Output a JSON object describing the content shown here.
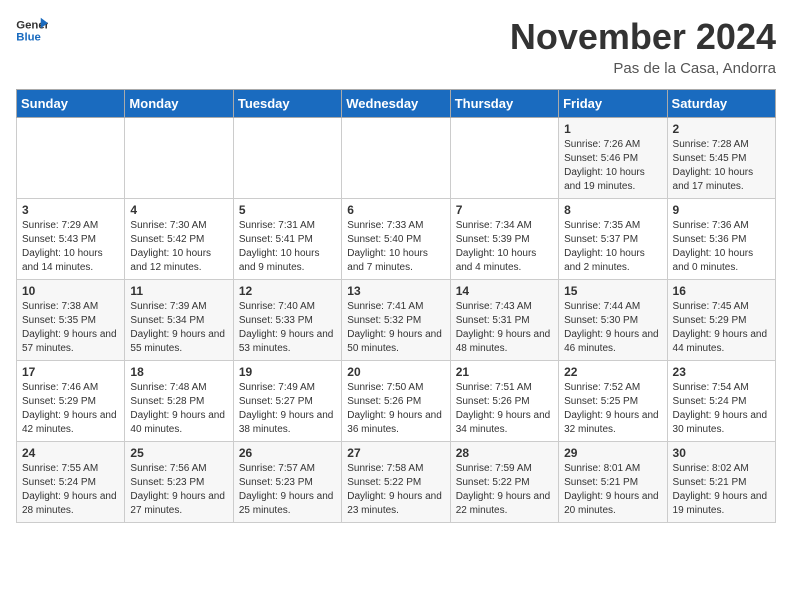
{
  "logo": {
    "line1": "General",
    "line2": "Blue"
  },
  "title": "November 2024",
  "subtitle": "Pas de la Casa, Andorra",
  "weekdays": [
    "Sunday",
    "Monday",
    "Tuesday",
    "Wednesday",
    "Thursday",
    "Friday",
    "Saturday"
  ],
  "weeks": [
    [
      {
        "day": "",
        "info": ""
      },
      {
        "day": "",
        "info": ""
      },
      {
        "day": "",
        "info": ""
      },
      {
        "day": "",
        "info": ""
      },
      {
        "day": "",
        "info": ""
      },
      {
        "day": "1",
        "info": "Sunrise: 7:26 AM\nSunset: 5:46 PM\nDaylight: 10 hours and 19 minutes."
      },
      {
        "day": "2",
        "info": "Sunrise: 7:28 AM\nSunset: 5:45 PM\nDaylight: 10 hours and 17 minutes."
      }
    ],
    [
      {
        "day": "3",
        "info": "Sunrise: 7:29 AM\nSunset: 5:43 PM\nDaylight: 10 hours and 14 minutes."
      },
      {
        "day": "4",
        "info": "Sunrise: 7:30 AM\nSunset: 5:42 PM\nDaylight: 10 hours and 12 minutes."
      },
      {
        "day": "5",
        "info": "Sunrise: 7:31 AM\nSunset: 5:41 PM\nDaylight: 10 hours and 9 minutes."
      },
      {
        "day": "6",
        "info": "Sunrise: 7:33 AM\nSunset: 5:40 PM\nDaylight: 10 hours and 7 minutes."
      },
      {
        "day": "7",
        "info": "Sunrise: 7:34 AM\nSunset: 5:39 PM\nDaylight: 10 hours and 4 minutes."
      },
      {
        "day": "8",
        "info": "Sunrise: 7:35 AM\nSunset: 5:37 PM\nDaylight: 10 hours and 2 minutes."
      },
      {
        "day": "9",
        "info": "Sunrise: 7:36 AM\nSunset: 5:36 PM\nDaylight: 10 hours and 0 minutes."
      }
    ],
    [
      {
        "day": "10",
        "info": "Sunrise: 7:38 AM\nSunset: 5:35 PM\nDaylight: 9 hours and 57 minutes."
      },
      {
        "day": "11",
        "info": "Sunrise: 7:39 AM\nSunset: 5:34 PM\nDaylight: 9 hours and 55 minutes."
      },
      {
        "day": "12",
        "info": "Sunrise: 7:40 AM\nSunset: 5:33 PM\nDaylight: 9 hours and 53 minutes."
      },
      {
        "day": "13",
        "info": "Sunrise: 7:41 AM\nSunset: 5:32 PM\nDaylight: 9 hours and 50 minutes."
      },
      {
        "day": "14",
        "info": "Sunrise: 7:43 AM\nSunset: 5:31 PM\nDaylight: 9 hours and 48 minutes."
      },
      {
        "day": "15",
        "info": "Sunrise: 7:44 AM\nSunset: 5:30 PM\nDaylight: 9 hours and 46 minutes."
      },
      {
        "day": "16",
        "info": "Sunrise: 7:45 AM\nSunset: 5:29 PM\nDaylight: 9 hours and 44 minutes."
      }
    ],
    [
      {
        "day": "17",
        "info": "Sunrise: 7:46 AM\nSunset: 5:29 PM\nDaylight: 9 hours and 42 minutes."
      },
      {
        "day": "18",
        "info": "Sunrise: 7:48 AM\nSunset: 5:28 PM\nDaylight: 9 hours and 40 minutes."
      },
      {
        "day": "19",
        "info": "Sunrise: 7:49 AM\nSunset: 5:27 PM\nDaylight: 9 hours and 38 minutes."
      },
      {
        "day": "20",
        "info": "Sunrise: 7:50 AM\nSunset: 5:26 PM\nDaylight: 9 hours and 36 minutes."
      },
      {
        "day": "21",
        "info": "Sunrise: 7:51 AM\nSunset: 5:26 PM\nDaylight: 9 hours and 34 minutes."
      },
      {
        "day": "22",
        "info": "Sunrise: 7:52 AM\nSunset: 5:25 PM\nDaylight: 9 hours and 32 minutes."
      },
      {
        "day": "23",
        "info": "Sunrise: 7:54 AM\nSunset: 5:24 PM\nDaylight: 9 hours and 30 minutes."
      }
    ],
    [
      {
        "day": "24",
        "info": "Sunrise: 7:55 AM\nSunset: 5:24 PM\nDaylight: 9 hours and 28 minutes."
      },
      {
        "day": "25",
        "info": "Sunrise: 7:56 AM\nSunset: 5:23 PM\nDaylight: 9 hours and 27 minutes."
      },
      {
        "day": "26",
        "info": "Sunrise: 7:57 AM\nSunset: 5:23 PM\nDaylight: 9 hours and 25 minutes."
      },
      {
        "day": "27",
        "info": "Sunrise: 7:58 AM\nSunset: 5:22 PM\nDaylight: 9 hours and 23 minutes."
      },
      {
        "day": "28",
        "info": "Sunrise: 7:59 AM\nSunset: 5:22 PM\nDaylight: 9 hours and 22 minutes."
      },
      {
        "day": "29",
        "info": "Sunrise: 8:01 AM\nSunset: 5:21 PM\nDaylight: 9 hours and 20 minutes."
      },
      {
        "day": "30",
        "info": "Sunrise: 8:02 AM\nSunset: 5:21 PM\nDaylight: 9 hours and 19 minutes."
      }
    ]
  ]
}
